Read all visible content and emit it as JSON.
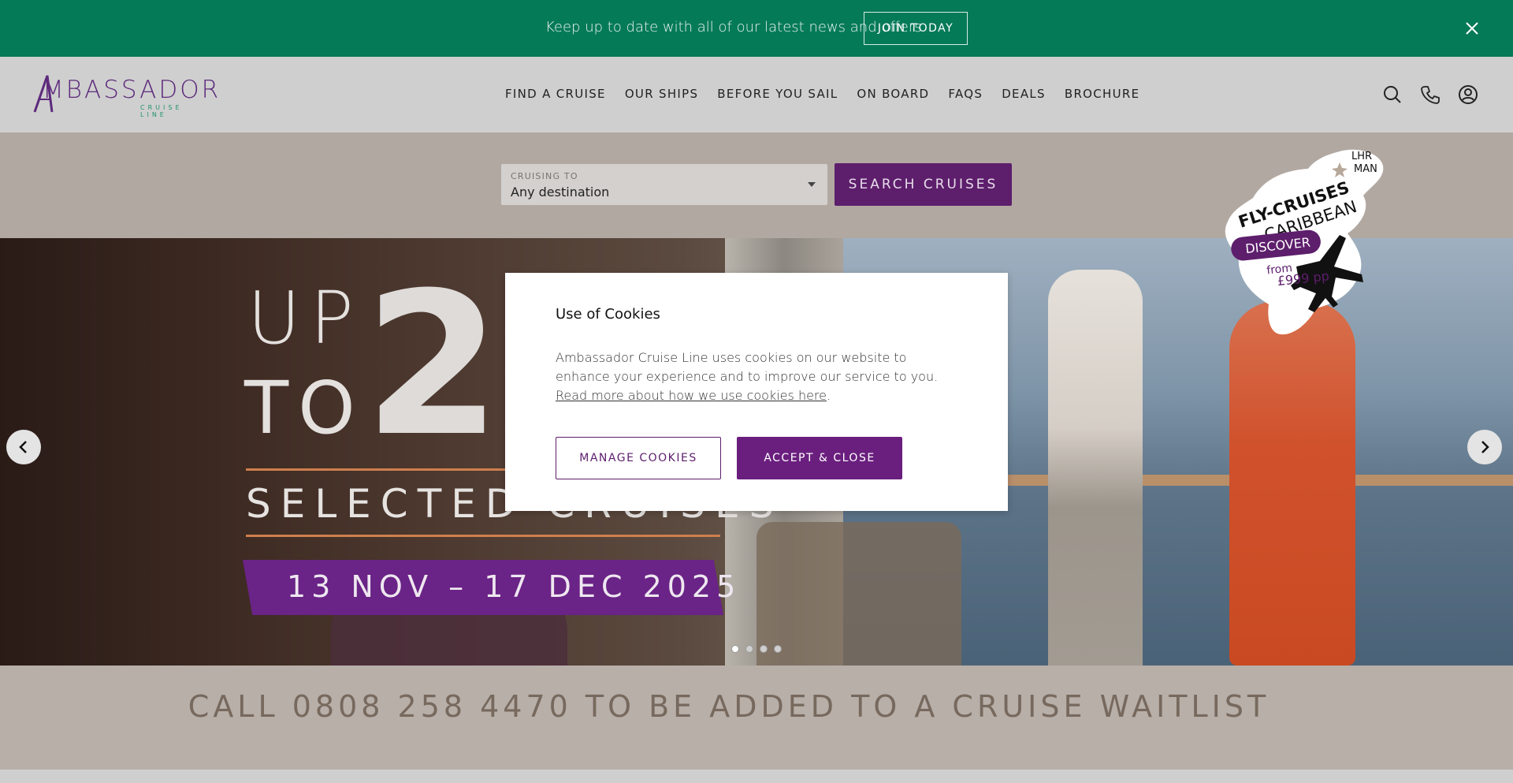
{
  "topbar": {
    "text": "Keep up to date with all of our latest news and offers",
    "join_label": "JOIN TODAY"
  },
  "header": {
    "logo_main": "MBASSADOR",
    "logo_sub": "CRUISE LINE",
    "nav": [
      "FIND A CRUISE",
      "OUR SHIPS",
      "BEFORE YOU SAIL",
      "ON BOARD",
      "FAQS",
      "DEALS",
      "BROCHURE"
    ]
  },
  "search": {
    "label": "CRUISING TO",
    "value": "Any destination",
    "button_label": "SEARCH CRUISES"
  },
  "hero": {
    "up": "UP",
    "to": "TO",
    "big_number": "2",
    "selected": "SELECTED CRUISES",
    "dates": "13 NOV – 17 DEC 2025",
    "slide_count": 4,
    "active_slide": 1
  },
  "sticker": {
    "line1": "FLY-CRUISES",
    "line2": "CARIBBEAN",
    "airports_1": "LHR",
    "airports_2": "MAN",
    "discover": "DISCOVER",
    "from": "from",
    "price": "£999 pp"
  },
  "cta": {
    "text": "CALL 0808 258 4470 TO BE ADDED TO A CRUISE WAITLIST"
  },
  "cookie_modal": {
    "title": "Use of Cookies",
    "body": "Ambassador Cruise Line uses cookies on our website to enhance your experience and to improve our service to you. ",
    "link": "Read more about how we use cookies here",
    "body_end": ".",
    "manage_label": "MANAGE COOKIES",
    "accept_label": "ACCEPT & CLOSE"
  },
  "colors": {
    "topbar": "#057a57",
    "brand_purple": "#5d1e6c",
    "accent_orange": "#cf7f4e"
  }
}
